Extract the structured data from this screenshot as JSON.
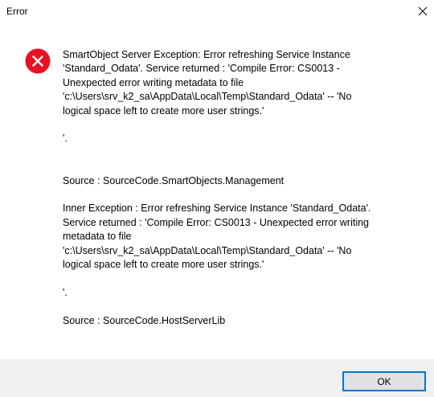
{
  "window": {
    "title": "Error",
    "close_icon": "close-icon"
  },
  "icon": {
    "name": "error-icon",
    "color": "#e81123"
  },
  "message": {
    "text": "SmartObject Server Exception: Error refreshing Service Instance\n'Standard_Odata'. Service returned : 'Compile Error: CS0013 -\nUnexpected error writing metadata to file\n'c:\\Users\\srv_k2_sa\\AppData\\Local\\Temp\\Standard_Odata' -- 'No\nlogical space left to create more user strings.'\n\n'.\n\n\nSource : SourceCode.SmartObjects.Management\n\nInner Exception : Error refreshing Service Instance 'Standard_Odata'.\nService returned : 'Compile Error: CS0013 - Unexpected error writing\nmetadata to file\n'c:\\Users\\srv_k2_sa\\AppData\\Local\\Temp\\Standard_Odata' -- 'No\nlogical space left to create more user strings.'\n\n'.\n\nSource : SourceCode.HostServerLib"
  },
  "buttons": {
    "ok_label": "OK"
  },
  "colors": {
    "accent": "#0078d7",
    "footer_bg": "#f0f0f0"
  }
}
